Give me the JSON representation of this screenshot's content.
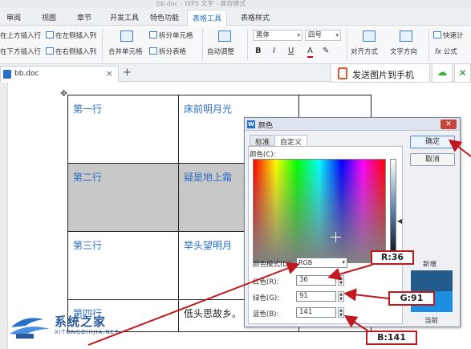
{
  "app": {
    "title": "bb.doc - WPS 文字 - 兼容模式"
  },
  "tabs": [
    "审阅",
    "视图",
    "章节",
    "开发工具",
    "特色功能",
    "表格工具",
    "表格样式"
  ],
  "active_tab": "表格工具",
  "ribbon": {
    "insert_above": "在上方插入行",
    "insert_left": "在左侧插入列",
    "insert_below": "在下方插入行",
    "insert_right": "在右侧插入列",
    "merge_cells": "合并单元格",
    "split_cells": "拆分单元格",
    "split_table": "拆分表格",
    "auto_adjust": "自动调整",
    "font_name": "黑体",
    "font_size": "四号",
    "bold": "B",
    "italic": "I",
    "underline": "U",
    "font_color": "A",
    "align": "对齐方式",
    "text_direction": "文字方向",
    "quick_calc": "快速计",
    "formula": "公式",
    "fx": "fx"
  },
  "doc_tab": {
    "name": "bb.doc",
    "close": "×",
    "add": "+"
  },
  "actions": {
    "send_to_phone": "发送图片到手机"
  },
  "table": {
    "rows": [
      [
        "第一行",
        "床前明月光",
        ""
      ],
      [
        "第二行",
        "疑是地上霜",
        ""
      ],
      [
        "第三行",
        "举头望明月",
        ""
      ],
      [
        "第四行",
        "低头思故乡。",
        ""
      ]
    ]
  },
  "dialog": {
    "title": "颜色",
    "tabs": [
      "标准",
      "自定义"
    ],
    "active_tab": "自定义",
    "color_label": "颜色(C):",
    "mode_label": "颜色模式(D):",
    "mode_value": "RGB",
    "fields": [
      {
        "label": "红色(R):",
        "value": "36"
      },
      {
        "label": "绿色(G):",
        "value": "91"
      },
      {
        "label": "蓝色(B):",
        "value": "141"
      }
    ],
    "ok": "确定",
    "cancel": "取消",
    "new_label": "新增",
    "current_label": "当前",
    "new_color": "#245b8d",
    "current_color": "#1e8fe0"
  },
  "callouts": {
    "red": "R:36",
    "green": "G:91",
    "blue": "B:141"
  },
  "watermark": {
    "cn": "系统之家",
    "en": "XITONGZHIJIA.NET"
  },
  "colors": {
    "accent": "#2b6fc7",
    "callout_border": "#c0181e",
    "highlight_gray": "#c8c8c8"
  }
}
